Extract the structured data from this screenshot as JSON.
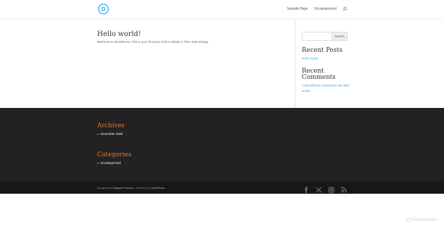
{
  "header": {
    "logo_letter": "D",
    "nav": [
      {
        "label": "Sample Page"
      },
      {
        "label": "Uncategorized"
      }
    ]
  },
  "post": {
    "title": "Hello world!",
    "excerpt": "Welcome to WordPress. This is your first post. Edit or delete it, then start writing!"
  },
  "sidebar": {
    "search_button": "Search",
    "recent_posts_title": "Recent Posts",
    "recent_posts": [
      "Hello world!"
    ],
    "recent_comments_title_1": "Recent",
    "recent_comments_title_2": "Comments",
    "comment_author": "A WordPress Commenter",
    "comment_on": "on",
    "comment_post": "Hello world!"
  },
  "footer": {
    "archives_title": "Archives",
    "archives": [
      "December 2025"
    ],
    "categories_title": "Categories",
    "categories": [
      "Uncategorized"
    ]
  },
  "bottom": {
    "designed_by": "Designed by",
    "elegant_themes": "Elegant Themes",
    "powered_by": "| Powered by",
    "wordpress": "WordPress",
    "social_icons": [
      "facebook-icon",
      "x-icon",
      "instagram-icon",
      "rss-icon"
    ]
  },
  "watermark": "ScanMalware",
  "colors": {
    "accent": "#2ea3f2",
    "footer_title": "#e0793a",
    "footer_bg": "#222222"
  }
}
